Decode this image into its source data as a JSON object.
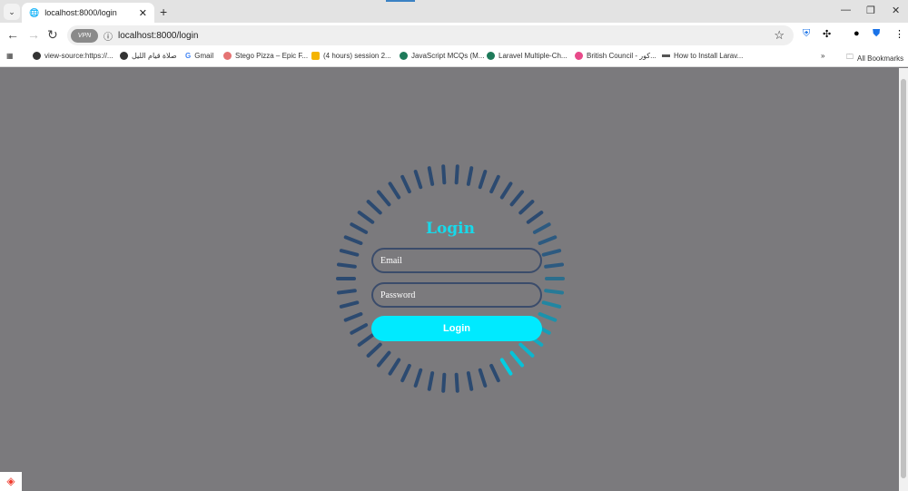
{
  "browser": {
    "tab_title": "localhost:8000/login",
    "url": "localhost:8000/login",
    "vpn_label": "VPN",
    "bookmarks": [
      "view-source:https://...",
      "صلاة قيام الليل",
      "Gmail",
      "Stego Pizza – Epic F...",
      "(4 hours) session 2...",
      "JavaScript MCQs (M...",
      "Laravel Multiple-Ch...",
      "British Council - كور...",
      "How to Install Larav..."
    ],
    "all_bookmarks": "All Bookmarks"
  },
  "login": {
    "title": "Login",
    "email_placeholder": "Email",
    "password_placeholder": "Password",
    "button": "Login"
  },
  "colors": {
    "accent": "#00eaff",
    "bar": "#2c4a70",
    "background": "#7b7a7d"
  }
}
